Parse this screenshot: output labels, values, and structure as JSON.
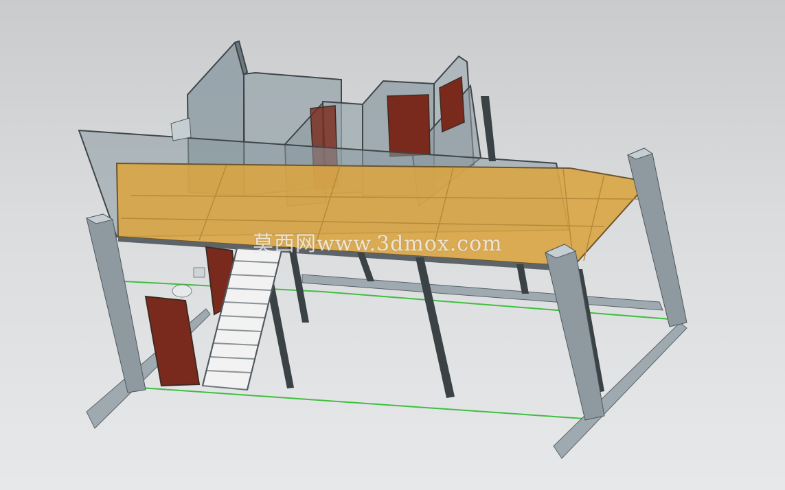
{
  "viewport": {
    "background_top": "#c9cbcd",
    "background_bottom": "#e6e8ea"
  },
  "model": {
    "description_items": [
      "mezzanine-platform",
      "glass-booths",
      "staircase",
      "doors",
      "steel-columns"
    ],
    "colors": {
      "floor_panel": "#d9a544",
      "glass": "#8f9ea4",
      "frame": "#3f4549",
      "column": "#8e9aa0",
      "door": "#7a2a1c",
      "ground_line": "#3fbf3f"
    }
  },
  "watermark": {
    "text": "莫西网www.3dmox.com"
  }
}
